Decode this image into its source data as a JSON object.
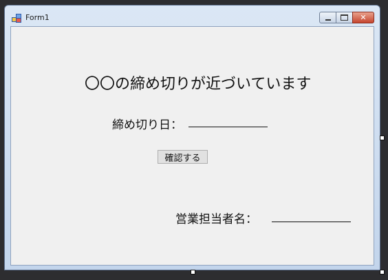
{
  "window": {
    "title": "Form1",
    "controls": {
      "minimize": "minimize",
      "maximize": "maximize",
      "close": "✕"
    }
  },
  "form": {
    "heading": "〇〇の締め切りが近づいています",
    "deadline_label": "締め切り日：",
    "confirm_button": "確認する",
    "staff_label": "営業担当者名："
  },
  "icons": {
    "app": "form-app-icon",
    "minimize": "minimize-icon",
    "maximize": "maximize-icon",
    "close": "close-icon"
  }
}
